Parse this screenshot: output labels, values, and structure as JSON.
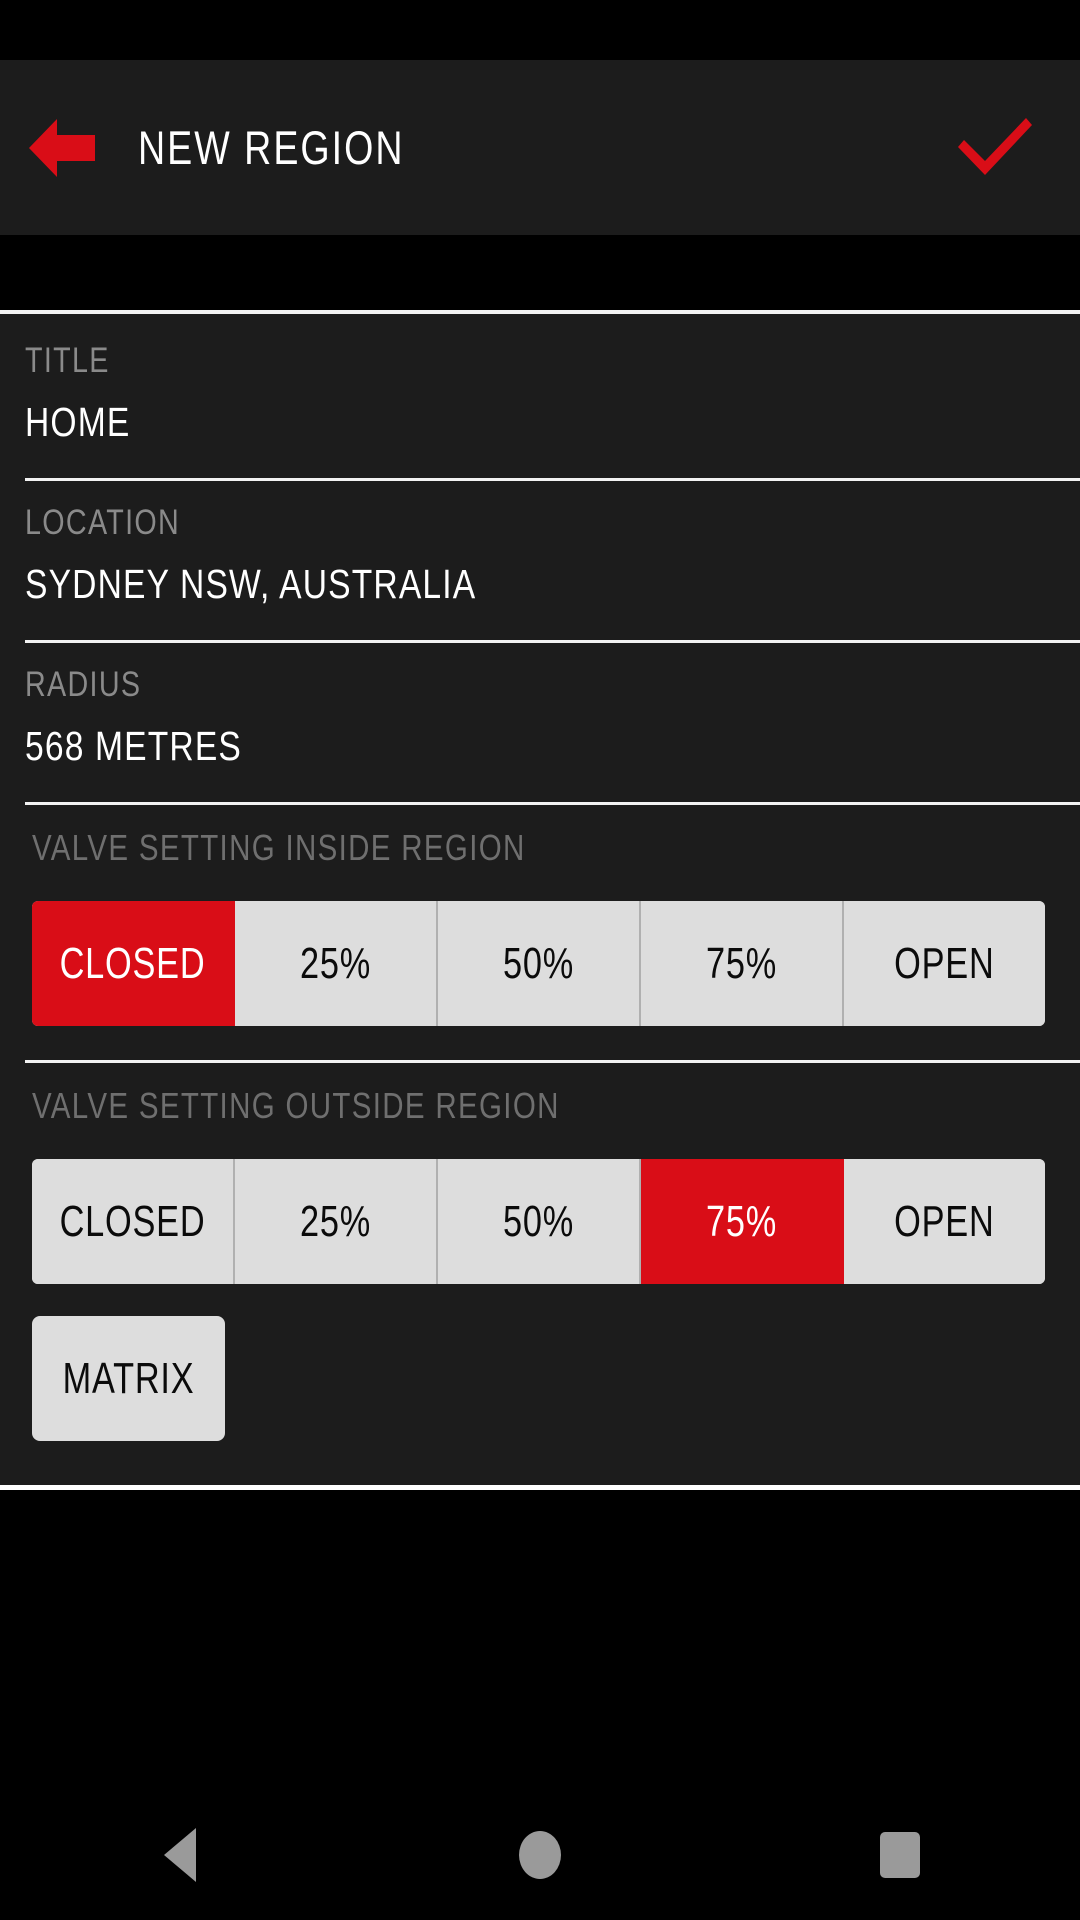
{
  "app_bar": {
    "back_icon": "arrow-left-icon",
    "title": "NEW REGION",
    "confirm_icon": "check-icon",
    "accent_color": "#d90d17"
  },
  "form": {
    "fields": [
      {
        "label": "TITLE",
        "value": "HOME"
      },
      {
        "label": "LOCATION",
        "value": "SYDNEY NSW, AUSTRALIA"
      },
      {
        "label": "RADIUS",
        "value": "568 METRES"
      }
    ]
  },
  "valve_inside": {
    "label": "VALVE SETTING INSIDE REGION",
    "options": [
      "CLOSED",
      "25%",
      "50%",
      "75%",
      "OPEN"
    ],
    "selected_index": 0,
    "selected_value": "CLOSED"
  },
  "valve_outside": {
    "label": "VALVE SETTING OUTSIDE REGION",
    "options": [
      "CLOSED",
      "25%",
      "50%",
      "75%",
      "OPEN"
    ],
    "selected_index": 3,
    "selected_value": "75%"
  },
  "matrix_button": {
    "label": "MATRIX"
  },
  "nav_bar": {
    "back_icon": "triangle-back-icon",
    "home_icon": "circle-home-icon",
    "recents_icon": "square-recents-icon"
  },
  "colors": {
    "accent_red": "#d90d17",
    "card_background": "#1c1c1c",
    "screen_background": "#000000",
    "segment_background": "#dddddd",
    "label_text": "#8a8a8a",
    "value_text": "#ffffff",
    "divider": "#f2f2f2"
  }
}
